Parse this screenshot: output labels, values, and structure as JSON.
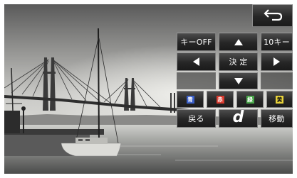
{
  "remote": {
    "back_icon": "return-arrow-icon",
    "row1": {
      "key_off": "キーOFF",
      "up_icon": "arrow-up-icon",
      "ten_key": "10キー"
    },
    "row2": {
      "left_icon": "arrow-left-icon",
      "enter": "決 定",
      "right_icon": "arrow-right-icon"
    },
    "row3": {
      "down_icon": "arrow-down-icon"
    },
    "colors": [
      {
        "char": "青",
        "color": "#3a5fc8"
      },
      {
        "char": "赤",
        "color": "#d83a2e"
      },
      {
        "char": "緑",
        "color": "#4aa84a"
      },
      {
        "char": "黄",
        "color": "#e8d23a"
      }
    ],
    "bottom": {
      "return_label": "戻る",
      "d_label": "d",
      "move_label": "移動"
    }
  },
  "colors": {
    "button_bg": "#2a2a2a",
    "button_border": "#7a7a7a",
    "text": "#ffffff"
  }
}
